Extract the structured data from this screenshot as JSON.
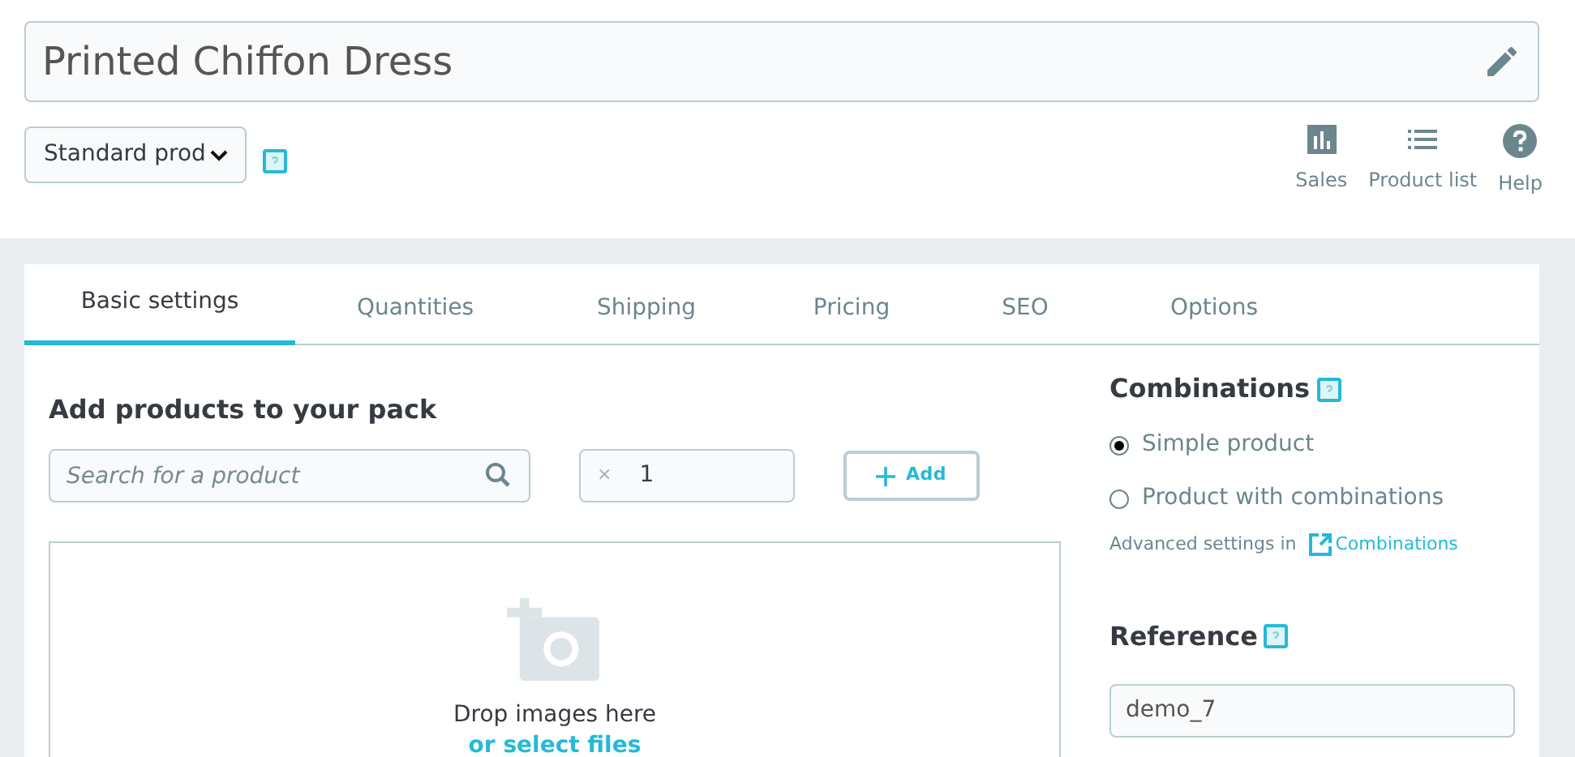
{
  "product_name": {
    "value": "Printed Chiffon Dress"
  },
  "product_type": {
    "value": "Standard prod"
  },
  "toolbar": [
    {
      "kind": "sales",
      "label": "Sales"
    },
    {
      "kind": "list",
      "label": "Product list"
    },
    {
      "kind": "help",
      "label": "Help"
    }
  ],
  "tabs": [
    {
      "label": "Basic settings",
      "selected": true
    },
    {
      "label": "Quantities",
      "selected": false
    },
    {
      "label": "Shipping",
      "selected": false
    },
    {
      "label": "Pricing",
      "selected": false
    },
    {
      "label": "SEO",
      "selected": false
    },
    {
      "label": "Options",
      "selected": false
    }
  ],
  "pack": {
    "title": "Add products to your pack",
    "search_placeholder": "Search for a product",
    "times": "×",
    "quantity": "1",
    "add_button": "Add"
  },
  "dropzone": {
    "text": "Drop images here",
    "link": "or select files"
  },
  "combinations": {
    "title": "Combinations",
    "options": [
      {
        "label": "Simple product",
        "selected": true
      },
      {
        "label": "Product with combinations",
        "selected": false
      }
    ],
    "advanced_text": "Advanced settings in",
    "advanced_link": "Combinations"
  },
  "reference": {
    "title": "Reference",
    "value": "demo_7"
  }
}
